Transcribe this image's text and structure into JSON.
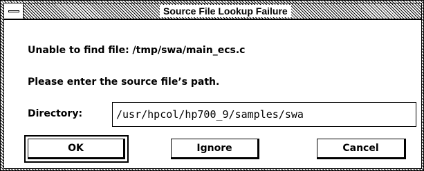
{
  "window": {
    "title": "Source File Lookup Failure"
  },
  "dialog": {
    "message": "Unable to find file: /tmp/swa/main_ecs.c",
    "prompt": "Please enter the source file’s path.",
    "directory_label": "Directory:",
    "directory_value": "/usr/hpcol/hp700_9/samples/swa"
  },
  "buttons": {
    "ok_label": "OK",
    "ignore_label": "Ignore",
    "cancel_label": "Cancel"
  },
  "icons": {
    "system_menu": "window-menu-icon"
  }
}
